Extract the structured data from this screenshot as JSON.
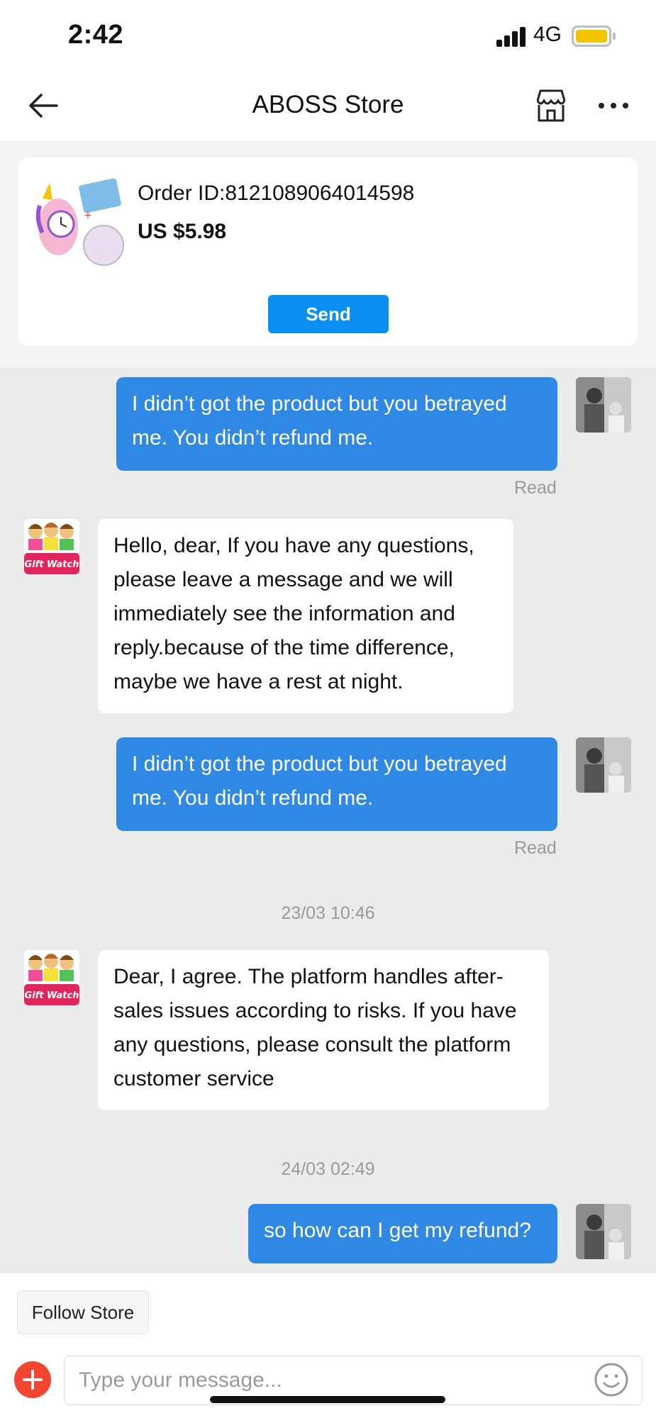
{
  "status_bar": {
    "time": "2:42",
    "network": "4G",
    "battery_color": "#f5c400",
    "icons": [
      "signal-bars-icon",
      "battery-icon"
    ]
  },
  "nav": {
    "title": "ABOSS Store",
    "icons": [
      "back-arrow-icon",
      "store-icon",
      "more-dots-icon"
    ]
  },
  "order_card": {
    "order_id": "Order ID:8121089064014598",
    "price": "US $5.98",
    "send_label": "Send"
  },
  "messages": [
    {
      "direction": "out",
      "text": "I didn’t got the product but you betrayed me. You didn’t refund me.",
      "status": "Read"
    },
    {
      "direction": "in",
      "text": "Hello, dear, If you have any questions, please leave a message and we will immediately see the information and reply.because of the time difference, maybe we have a rest at night.",
      "avatar_label": "Gift Watch"
    },
    {
      "direction": "out",
      "text": "I didn’t got the product but you betrayed me. You didn’t refund me.",
      "status": "Read"
    },
    {
      "timestamp": "23/03 10:46"
    },
    {
      "direction": "in",
      "text": "Dear, I agree. The platform handles after-sales issues according to risks. If you have any questions, please consult the platform customer service",
      "avatar_label": "Gift Watch"
    },
    {
      "timestamp": "24/03 02:49"
    },
    {
      "direction": "out",
      "text": "so how can I get my refund?"
    }
  ],
  "bottom": {
    "follow_label": "Follow Store",
    "input_placeholder": "Type your message...",
    "icons": [
      "plus-circle-icon",
      "smiley-icon"
    ]
  },
  "colors": {
    "accent": "#0a8ef2",
    "outgoing_bubble": "#2e88e4",
    "add_button": "#f3452f"
  }
}
